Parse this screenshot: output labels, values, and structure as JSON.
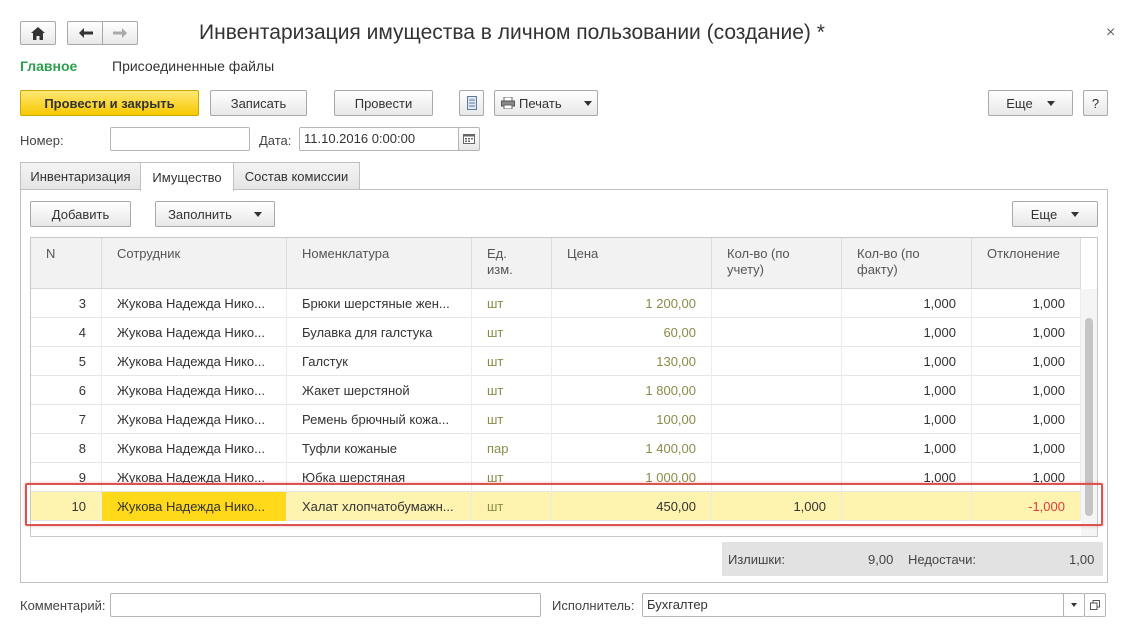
{
  "window": {
    "title": "Инвентаризация имущества в личном пользовании (создание) *",
    "close": "×"
  },
  "sections": {
    "main": "Главное",
    "files": "Присоединенные файлы"
  },
  "toolbar": {
    "post_close": "Провести и закрыть",
    "save": "Записать",
    "post": "Провести",
    "print": "Печать",
    "more": "Еще",
    "help": "?"
  },
  "header": {
    "number_label": "Номер:",
    "number_value": "",
    "date_label": "Дата:",
    "date_value": "11.10.2016  0:00:00"
  },
  "tabs": [
    {
      "label": "Инвентаризация"
    },
    {
      "label": "Имущество"
    },
    {
      "label": "Состав комиссии"
    }
  ],
  "table_toolbar": {
    "add": "Добавить",
    "fill": "Заполнить",
    "more": "Еще"
  },
  "columns": [
    "N",
    "Сотрудник",
    "Номенклатура",
    "Ед. изм.",
    "Цена",
    "Кол-во (по учету)",
    "Кол-во (по факту)",
    "Отклонение"
  ],
  "rows": [
    {
      "n": "3",
      "employee": "Жукова Надежда Нико...",
      "item": "Брюки шерстяные жен...",
      "unit": "шт",
      "price": "1 200,00",
      "qty_account": "",
      "qty_fact": "1,000",
      "deviation": "1,000"
    },
    {
      "n": "4",
      "employee": "Жукова Надежда Нико...",
      "item": "Булавка для галстука",
      "unit": "шт",
      "price": "60,00",
      "qty_account": "",
      "qty_fact": "1,000",
      "deviation": "1,000"
    },
    {
      "n": "5",
      "employee": "Жукова Надежда Нико...",
      "item": "Галстук",
      "unit": "шт",
      "price": "130,00",
      "qty_account": "",
      "qty_fact": "1,000",
      "deviation": "1,000"
    },
    {
      "n": "6",
      "employee": "Жукова Надежда Нико...",
      "item": "Жакет шерстяной",
      "unit": "шт",
      "price": "1 800,00",
      "qty_account": "",
      "qty_fact": "1,000",
      "deviation": "1,000"
    },
    {
      "n": "7",
      "employee": "Жукова Надежда Нико...",
      "item": "Ремень брючный кожа...",
      "unit": "шт",
      "price": "100,00",
      "qty_account": "",
      "qty_fact": "1,000",
      "deviation": "1,000"
    },
    {
      "n": "8",
      "employee": "Жукова Надежда Нико...",
      "item": "Туфли кожаные",
      "unit": "пар",
      "price": "1 400,00",
      "qty_account": "",
      "qty_fact": "1,000",
      "deviation": "1,000"
    },
    {
      "n": "9",
      "employee": "Жукова Надежда Нико...",
      "item": "Юбка шерстяная",
      "unit": "шт",
      "price": "1 000,00",
      "qty_account": "",
      "qty_fact": "1,000",
      "deviation": "1,000"
    },
    {
      "n": "10",
      "employee": "Жукова Надежда Нико...",
      "item": "Халат хлопчатобумажн...",
      "unit": "шт",
      "price": "450,00",
      "qty_account": "1,000",
      "qty_fact": "",
      "deviation": "-1,000"
    }
  ],
  "totals": {
    "surplus_label": "Излишки:",
    "surplus_value": "9,00",
    "shortage_label": "Недостачи:",
    "shortage_value": "1,00"
  },
  "footer": {
    "comment_label": "Комментарий:",
    "comment_value": "",
    "executor_label": "Исполнитель:",
    "executor_value": "Бухгалтер"
  },
  "colors": {
    "accent_green": "#2e9e4f",
    "selection_row": "#fff3b0",
    "selection_cell": "#ffd91a",
    "negative": "#e03c3c"
  }
}
